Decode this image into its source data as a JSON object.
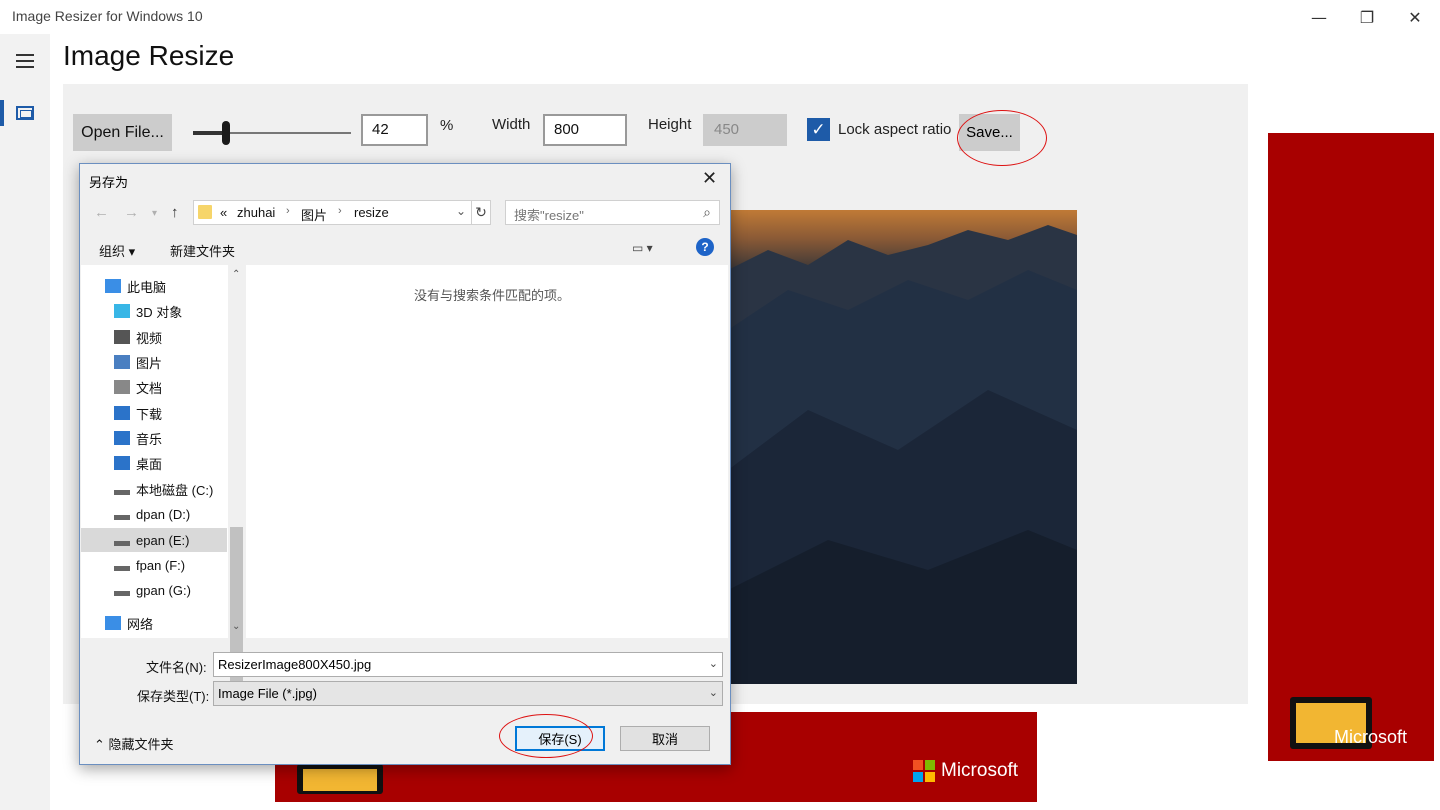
{
  "window": {
    "title": "Image Resizer for Windows 10",
    "minimize_glyph": "—",
    "maximize_glyph": "❐",
    "close_glyph": "✕"
  },
  "page": {
    "title": "Image Resize"
  },
  "toolbar": {
    "open_label": "Open File...",
    "scale_percent": "42",
    "percent_sign": "%",
    "width_label": "Width",
    "width_value": "800",
    "height_label": "Height",
    "height_value": "450",
    "lock_label": "Lock aspect ratio",
    "lock_checked": true,
    "save_label": "Save...",
    "slider_value_percent": 42
  },
  "ads": {
    "brand": "Microsoft"
  },
  "dialog": {
    "title": "另存为",
    "breadcrumbs": [
      "«",
      "zhuhai",
      "图片",
      "resize"
    ],
    "search_placeholder": "搜索\"resize\"",
    "organize_label": "组织 ▾",
    "new_folder_label": "新建文件夹",
    "help_glyph": "?",
    "empty_message": "没有与搜索条件匹配的项。",
    "tree": [
      {
        "label": "此电脑",
        "icon": "computer-icon"
      },
      {
        "label": "3D 对象",
        "icon": "cube-icon"
      },
      {
        "label": "视频",
        "icon": "video-icon"
      },
      {
        "label": "图片",
        "icon": "picture-icon"
      },
      {
        "label": "文档",
        "icon": "document-icon"
      },
      {
        "label": "下载",
        "icon": "download-icon"
      },
      {
        "label": "音乐",
        "icon": "music-icon"
      },
      {
        "label": "桌面",
        "icon": "desktop-icon"
      },
      {
        "label": "本地磁盘 (C:)",
        "icon": "drive-icon"
      },
      {
        "label": "dpan (D:)",
        "icon": "drive-icon"
      },
      {
        "label": "epan (E:)",
        "icon": "drive-icon",
        "selected": true
      },
      {
        "label": "fpan (F:)",
        "icon": "drive-icon"
      },
      {
        "label": "gpan (G:)",
        "icon": "drive-icon"
      },
      {
        "label": "网络",
        "icon": "network-icon"
      }
    ],
    "filename_label": "文件名(N):",
    "filename_value": "ResizerImage800X450.jpg",
    "filetype_label": "保存类型(T):",
    "filetype_value": "Image File (*.jpg)",
    "hide_folders_label": "隐藏文件夹",
    "save_button": "保存(S)",
    "cancel_button": "取消"
  },
  "colors": {
    "accent": "#1e5ba8",
    "ad_red": "#a80000",
    "highlight_circle": "#dd1111"
  }
}
